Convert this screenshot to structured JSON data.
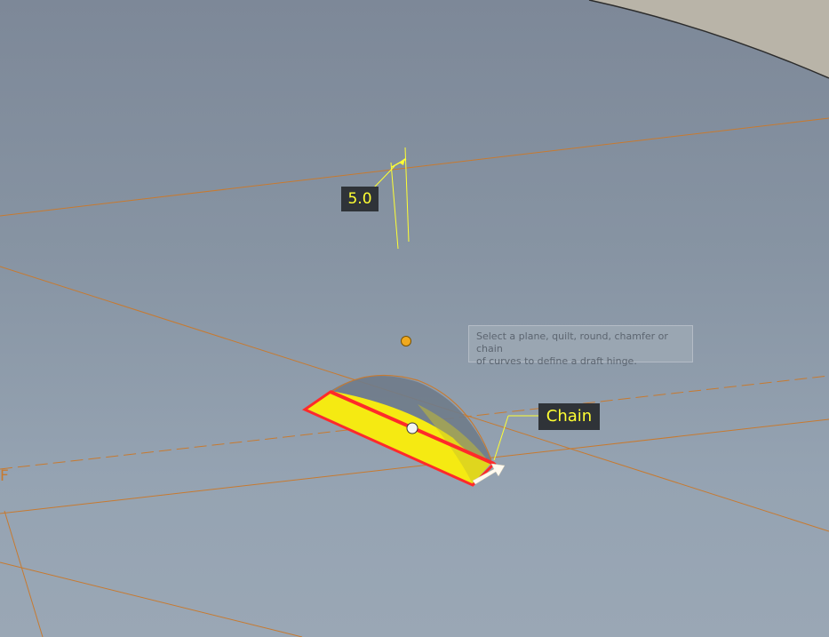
{
  "viewport": {
    "background_color": "#8f9cab",
    "datum_color": "#c77a30",
    "highlight_color": "#ff2a2a",
    "selection_fill": "#f5ea12"
  },
  "dimension": {
    "value": "5.0"
  },
  "chain_label": {
    "text": "Chain"
  },
  "tooltip": {
    "line1": "Select a plane, quilt, round, chamfer or chain",
    "line2": "of curves to define a draft hinge."
  },
  "plane_tag": {
    "text": "F"
  }
}
